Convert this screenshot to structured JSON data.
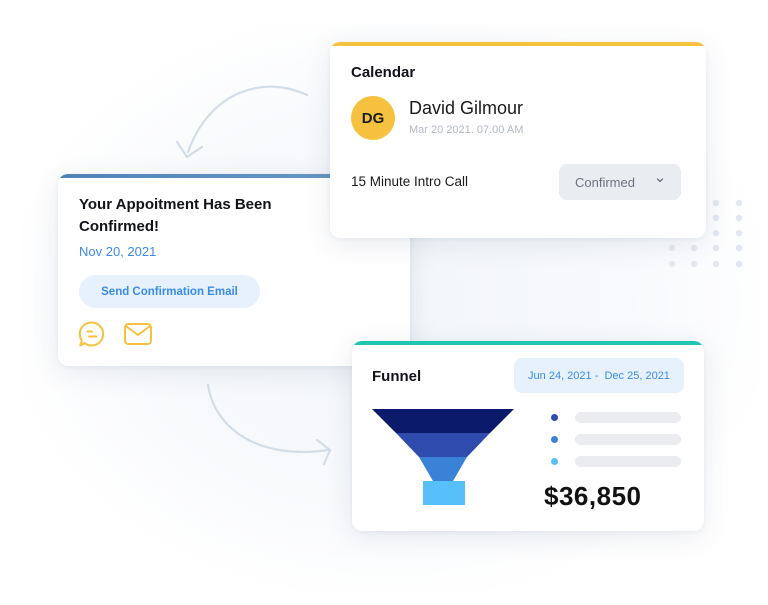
{
  "calendar": {
    "title": "Calendar",
    "accent": "#f5c13f",
    "contact": {
      "initials": "DG",
      "name": "David Gilmour",
      "datetime": "Mar 20 2021. 07.00 AM"
    },
    "event_name": "15 Minute Intro Call",
    "status": {
      "selected": "Confirmed",
      "icon": "chevron-down-icon"
    }
  },
  "appointment": {
    "headline": "Your Appoitment Has Been Confirmed!",
    "date": "Nov 20, 2021",
    "send_button": "Send Confirmation Email",
    "icons": [
      "chat-icon",
      "mail-icon"
    ],
    "accent": "#3b8be8",
    "icon_color": "#f5c13f"
  },
  "funnel": {
    "title": "Funnel",
    "date_range": "Jun 24, 2021 -  Dec 25, 2021",
    "stages": [
      {
        "color": "#0c1a6b"
      },
      {
        "color": "#2f4bad"
      },
      {
        "color": "#3a82d8"
      },
      {
        "color": "#57c0fb"
      }
    ],
    "legend_colors": [
      "#2f4bad",
      "#3a82d8",
      "#57c0fb"
    ],
    "amount": "$36,850",
    "accent": "#20c6b2"
  }
}
